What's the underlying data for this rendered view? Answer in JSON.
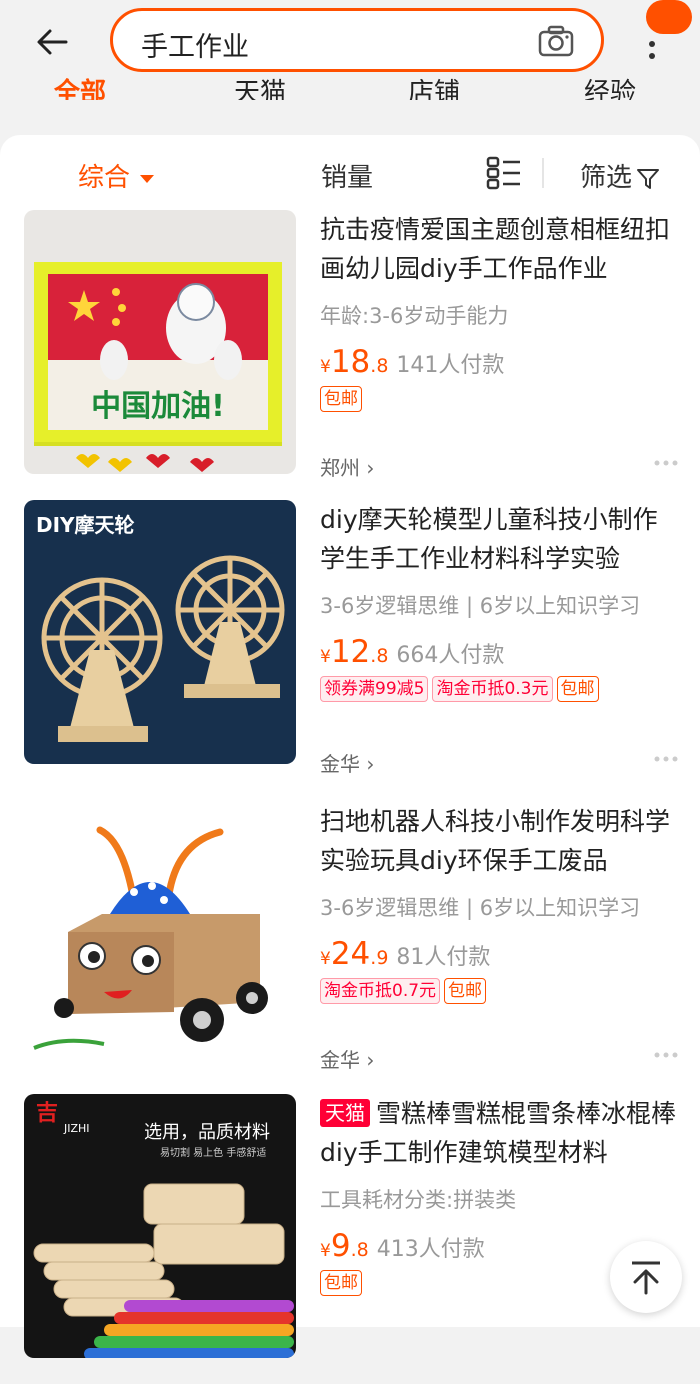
{
  "search": {
    "query": "手工作业"
  },
  "category_tabs": [
    "全部",
    "天猫",
    "店铺",
    "经验"
  ],
  "sort": {
    "comprehensive": "综合",
    "sales": "销量",
    "filter": "筛选"
  },
  "products": [
    {
      "title": "抗击疫情爱国主题创意相框纽扣画幼儿园diy手工作品作业",
      "attr": "年龄:3-6岁动手能力",
      "currency": "¥",
      "price_main": "18",
      "price_dec": ".8",
      "sold": "141人付款",
      "tags": [
        "包邮"
      ],
      "promo_tags": [],
      "city": "郑州 ›",
      "thumb_label": "中国加油!"
    },
    {
      "title": "diy摩天轮模型儿童科技小制作学生手工作业材料科学实验",
      "attr": "3-6岁逻辑思维 | 6岁以上知识学习",
      "currency": "¥",
      "price_main": "12",
      "price_dec": ".8",
      "sold": "664人付款",
      "tags": [
        "包邮"
      ],
      "promo_tags": [
        "领券满99减5",
        "淘金币抵0.3元"
      ],
      "city": "金华 ›",
      "thumb_label": "DIY摩天轮"
    },
    {
      "title": "扫地机器人科技小制作发明科学实验玩具diy环保手工废品",
      "attr": "3-6岁逻辑思维 | 6岁以上知识学习",
      "currency": "¥",
      "price_main": "24",
      "price_dec": ".9",
      "sold": "81人付款",
      "tags": [
        "包邮"
      ],
      "promo_tags": [
        "淘金币抵0.7元"
      ],
      "city": "金华 ›",
      "thumb_label": ""
    },
    {
      "tmall_badge": "天猫",
      "title": "雪糕棒雪糕棍雪条棒冰棍棒diy手工制作建筑模型材料",
      "attr": "工具耗材分类:拼装类",
      "currency": "¥",
      "price_main": "9",
      "price_dec": ".8",
      "sold": "413人付款",
      "tags": [
        "包邮"
      ],
      "promo_tags": [],
      "city": "",
      "thumb_label": "选用，品质材料",
      "thumb_sub": "易切割 易上色 手感舒适",
      "thumb_brand": "JIZHI"
    }
  ],
  "colors": {
    "accent": "#ff5000",
    "tmall": "#ff0036"
  }
}
